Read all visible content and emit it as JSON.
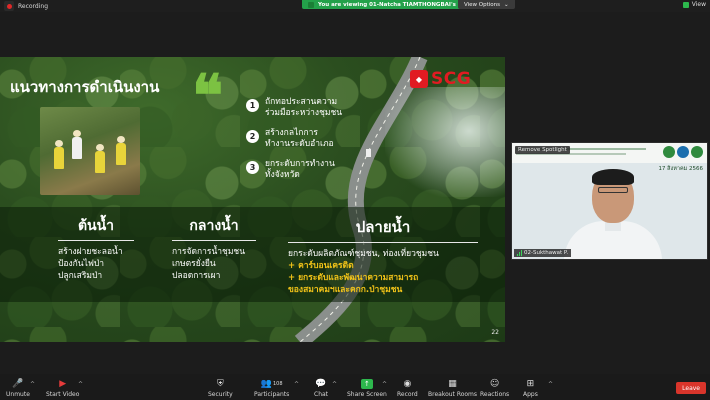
{
  "topbar": {
    "recording_label": "Recording",
    "viewing_label": "You are viewing 01-Natcha TIAMTHONGBAI's screen",
    "view_options_label": "View Options",
    "view_label": "View"
  },
  "slide": {
    "title": "แนวทางการดำเนินงาน",
    "quote_mark": "❝",
    "logo_text": "SCG",
    "page_number": "22",
    "steps": [
      {
        "num": "1",
        "line1": "ถักทอประสานความ",
        "line2": "ร่วมมือระหว่างชุมชน"
      },
      {
        "num": "2",
        "line1": "สร้างกลไกการ",
        "line2": "ทำงานระดับอำเภอ"
      },
      {
        "num": "3",
        "line1": "ยกระดับการทำงาน",
        "line2": "ทั้งจังหวัด"
      }
    ],
    "columns": {
      "upstream": {
        "heading": "ต้นน้ำ",
        "lines": [
          "สร้างฝายชะลอน้ำ",
          "ป้องกันไฟป่า",
          "ปลูกเสริมป่า"
        ]
      },
      "midstream": {
        "heading": "กลางน้ำ",
        "lines": [
          "การจัดการน้ำชุมชน",
          "เกษตรยั่งยืน",
          "ปลอดการเผา"
        ]
      },
      "downstream": {
        "heading": "ปลายน้ำ",
        "line1": "ยกระดับผลิตภัณฑ์ชุมชน, ท่องเที่ยวชุมชน",
        "line2": "+ คาร์บอนเครดิต",
        "line3": "+ ยกระดับและพัฒนาความสามารถ",
        "line4": "ของสมาคมฯและคกก.ป่าชุมชน"
      }
    }
  },
  "video": {
    "spotlight_label": "Remove Spotlight",
    "date_label": "17 สิงหาคม 2566",
    "name_label": "02-Sukthawat P."
  },
  "toolbar": {
    "unmute": "Unmute",
    "start_video": "Start Video",
    "security": "Security",
    "participants": "Participants",
    "participants_count": "108",
    "chat": "Chat",
    "share_screen": "Share Screen",
    "record": "Record",
    "breakout_rooms": "Breakout Rooms",
    "reactions": "Reactions",
    "apps": "Apps",
    "leave": "Leave"
  },
  "colors": {
    "accent_green": "#2db84d",
    "brand_red": "#e11b22",
    "highlight_yellow": "#f2c318",
    "leave_red": "#d9352b"
  }
}
